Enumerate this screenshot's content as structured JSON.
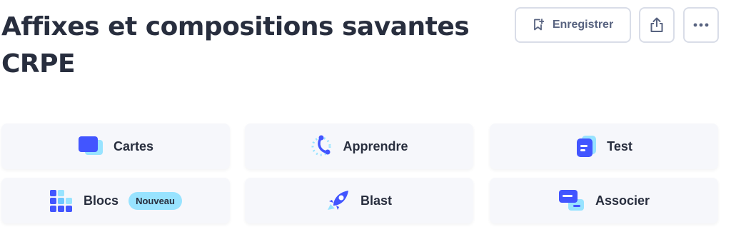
{
  "set": {
    "title": "Affixes et compositions savantes CRPE"
  },
  "header": {
    "save_label": "Enregistrer",
    "save_icon": "bookmark-plus-icon",
    "share_icon": "share-icon",
    "more_icon": "more-dots-icon"
  },
  "modes": {
    "cards": {
      "label": "Cartes",
      "icon": "cards-icon"
    },
    "learn": {
      "label": "Apprendre",
      "icon": "learn-progress-icon"
    },
    "test": {
      "label": "Test",
      "icon": "test-icon"
    },
    "blocks": {
      "label": "Blocs",
      "icon": "blocks-icon",
      "badge": "Nouveau"
    },
    "blast": {
      "label": "Blast",
      "icon": "rocket-icon"
    },
    "match": {
      "label": "Associer",
      "icon": "match-icon"
    }
  },
  "colors": {
    "text": "#282e3e",
    "muted": "#586380",
    "border": "#d9dde8",
    "tile_bg": "#f6f7fb",
    "primary": "#4255ff",
    "badge_bg": "#98e3ff",
    "light_blue": "#6ec7ff"
  }
}
